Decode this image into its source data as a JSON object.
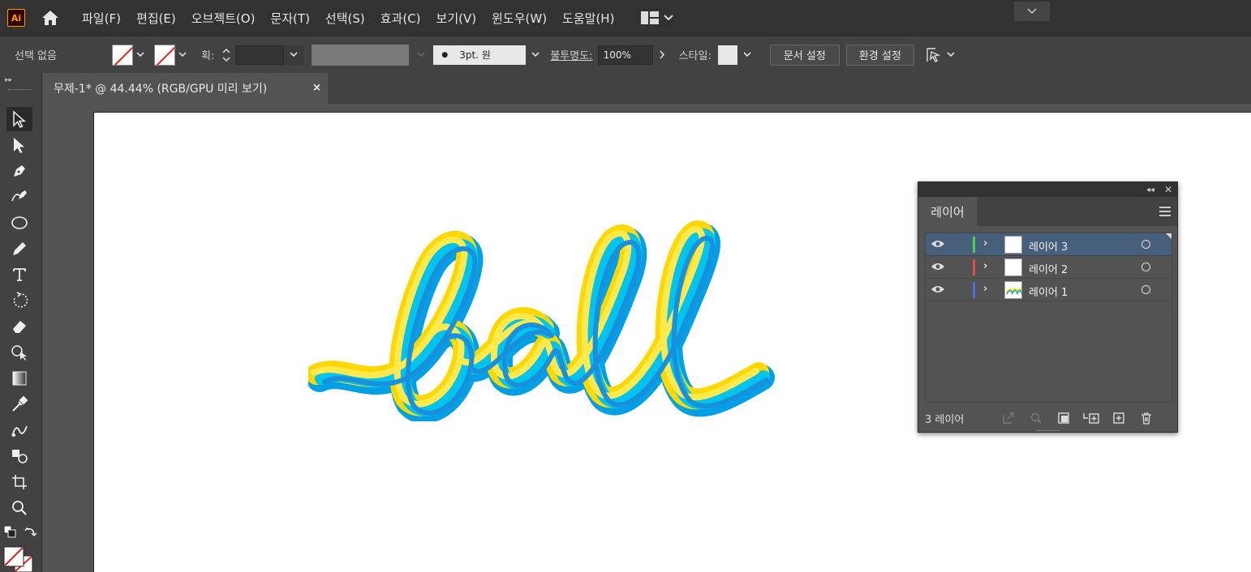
{
  "app": {
    "logo": "Ai"
  },
  "menu": [
    "파일(F)",
    "편집(E)",
    "오브젝트(O)",
    "문자(T)",
    "선택(S)",
    "효과(C)",
    "보기(V)",
    "윈도우(W)",
    "도움말(H)"
  ],
  "control": {
    "selection": "선택 없음",
    "stroke_label": "획:",
    "brush": "3pt. 원",
    "opacity_label": "불투명도:",
    "opacity_value": "100%",
    "style_label": "스타일:",
    "doc_setup": "문서 설정",
    "preferences": "환경 설정"
  },
  "document": {
    "tab_title": "무제-1* @ 44.44% (RGB/GPU 미리 보기)",
    "close": "×"
  },
  "layers_panel": {
    "tab": "레이어",
    "count": "3 레이어",
    "layers": [
      {
        "name": "레이어 3",
        "color": "#4fd14f",
        "selected": true
      },
      {
        "name": "레이어 2",
        "color": "#e04b4b",
        "selected": false
      },
      {
        "name": "레이어 1",
        "color": "#4b6fe0",
        "selected": false
      }
    ]
  },
  "colors": {
    "accent": "#46607c",
    "ui_dark": "#323232",
    "ui_mid": "#424242",
    "canvas": "#ffffff",
    "art_yellow": "#ffd800",
    "art_cyan": "#00b4e6"
  }
}
